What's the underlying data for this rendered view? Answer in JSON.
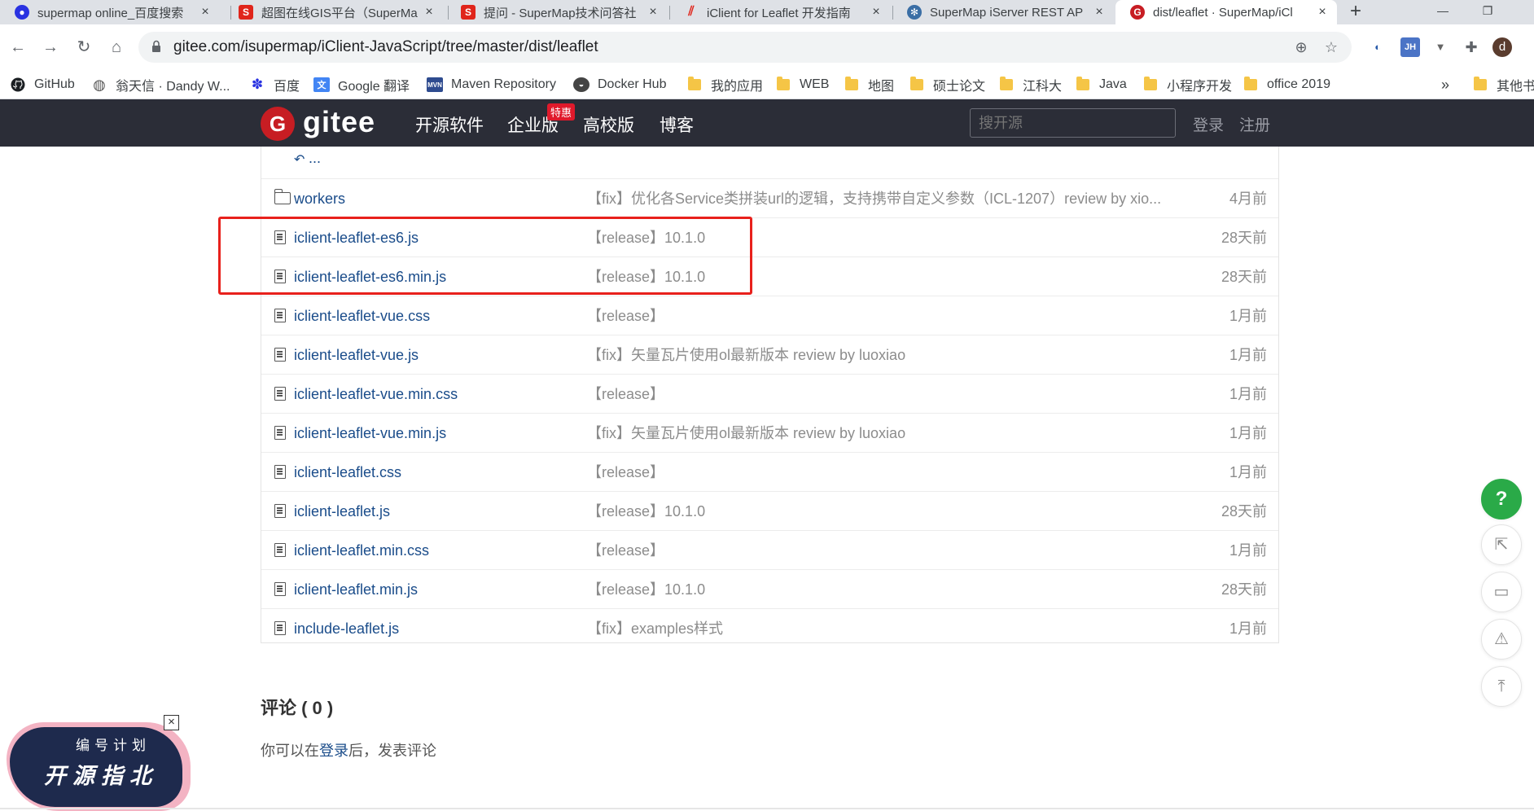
{
  "browser": {
    "tabs": [
      {
        "title": "supermap online_百度搜索",
        "favicon": "baidu-paw-icon",
        "color": "#2932e1"
      },
      {
        "title": "超图在线GIS平台（SuperMa",
        "favicon": "supermap-s-icon",
        "color": "#e0251b"
      },
      {
        "title": "提问 - SuperMap技术问答社",
        "favicon": "supermap-s-icon",
        "color": "#e0251b"
      },
      {
        "title": "iClient for Leaflet 开发指南",
        "favicon": "iclient-stripes-icon",
        "color": "#e0251b"
      },
      {
        "title": "SuperMap iServer REST AP",
        "favicon": "iserver-gear-icon",
        "color": "#3a6ea5"
      },
      {
        "title": "dist/leaflet · SuperMap/iCl",
        "favicon": "gitee-logo-icon",
        "color": "#c71d23"
      }
    ],
    "close_glyph": "×",
    "new_tab_glyph": "+",
    "url": "gitee.com/isupermap/iClient-JavaScript/tree/master/dist/leaflet",
    "profile_letter": "d",
    "ext_jh": "JH"
  },
  "bookmarks": [
    {
      "label": "GitHub",
      "icon": "github-icon"
    },
    {
      "label": "翁天信 · Dandy W...",
      "icon": "globe-icon"
    },
    {
      "label": "百度",
      "icon": "baidu-paw-icon"
    },
    {
      "label": "Google 翻译",
      "icon": "google-translate-icon"
    },
    {
      "label": "Maven Repository",
      "icon": "maven-icon"
    },
    {
      "label": "Docker Hub",
      "icon": "docker-icon"
    },
    {
      "label": "我的应用",
      "icon": "folder-icon"
    },
    {
      "label": "WEB",
      "icon": "folder-icon"
    },
    {
      "label": "地图",
      "icon": "folder-icon"
    },
    {
      "label": "硕士论文",
      "icon": "folder-icon"
    },
    {
      "label": "江科大",
      "icon": "folder-icon"
    },
    {
      "label": "Java",
      "icon": "folder-icon"
    },
    {
      "label": "小程序开发",
      "icon": "folder-icon"
    },
    {
      "label": "office 2019",
      "icon": "folder-icon"
    }
  ],
  "bookmarks_overflow": "»",
  "other_bookmarks": "其他书",
  "gitee": {
    "brand": "gitee",
    "logo_letter": "G",
    "nav": [
      "开源软件",
      "企业版",
      "高校版",
      "博客"
    ],
    "badge": "特惠",
    "search_placeholder": "搜开源",
    "login": "登录",
    "register": "注册"
  },
  "files": {
    "back_label": "...",
    "rows": [
      {
        "name": "workers",
        "type": "dir",
        "commit": "【fix】优化各Service类拼装url的逻辑，支持携带自定义参数（ICL-1207）review by xio...",
        "age": "4月前"
      },
      {
        "name": "iclient-leaflet-es6.js",
        "type": "file",
        "commit": "【release】10.1.0",
        "age": "28天前"
      },
      {
        "name": "iclient-leaflet-es6.min.js",
        "type": "file",
        "commit": "【release】10.1.0",
        "age": "28天前"
      },
      {
        "name": "iclient-leaflet-vue.css",
        "type": "file",
        "commit": "【release】",
        "age": "1月前"
      },
      {
        "name": "iclient-leaflet-vue.js",
        "type": "file",
        "commit": "【fix】矢量瓦片使用ol最新版本 review by luoxiao",
        "age": "1月前"
      },
      {
        "name": "iclient-leaflet-vue.min.css",
        "type": "file",
        "commit": "【release】",
        "age": "1月前"
      },
      {
        "name": "iclient-leaflet-vue.min.js",
        "type": "file",
        "commit": "【fix】矢量瓦片使用ol最新版本 review by luoxiao",
        "age": "1月前"
      },
      {
        "name": "iclient-leaflet.css",
        "type": "file",
        "commit": "【release】",
        "age": "1月前"
      },
      {
        "name": "iclient-leaflet.js",
        "type": "file",
        "commit": "【release】10.1.0",
        "age": "28天前"
      },
      {
        "name": "iclient-leaflet.min.css",
        "type": "file",
        "commit": "【release】",
        "age": "1月前"
      },
      {
        "name": "iclient-leaflet.min.js",
        "type": "file",
        "commit": "【release】10.1.0",
        "age": "28天前"
      },
      {
        "name": "include-leaflet.js",
        "type": "file",
        "commit": "【fix】examples样式",
        "age": "1月前"
      }
    ]
  },
  "comments": {
    "title": "评论 ( 0 )",
    "prefix": "你可以在",
    "login_link": "登录",
    "suffix": "后，发表评论"
  },
  "floating": {
    "help": "?"
  },
  "promo": {
    "line1": "编号计划",
    "line2": "开源指北",
    "close": "×"
  },
  "colors": {
    "gitee_header": "#2b2d37",
    "link": "#1a4c8a",
    "highlight": "#e8211c",
    "help_button": "#2aaa48"
  }
}
